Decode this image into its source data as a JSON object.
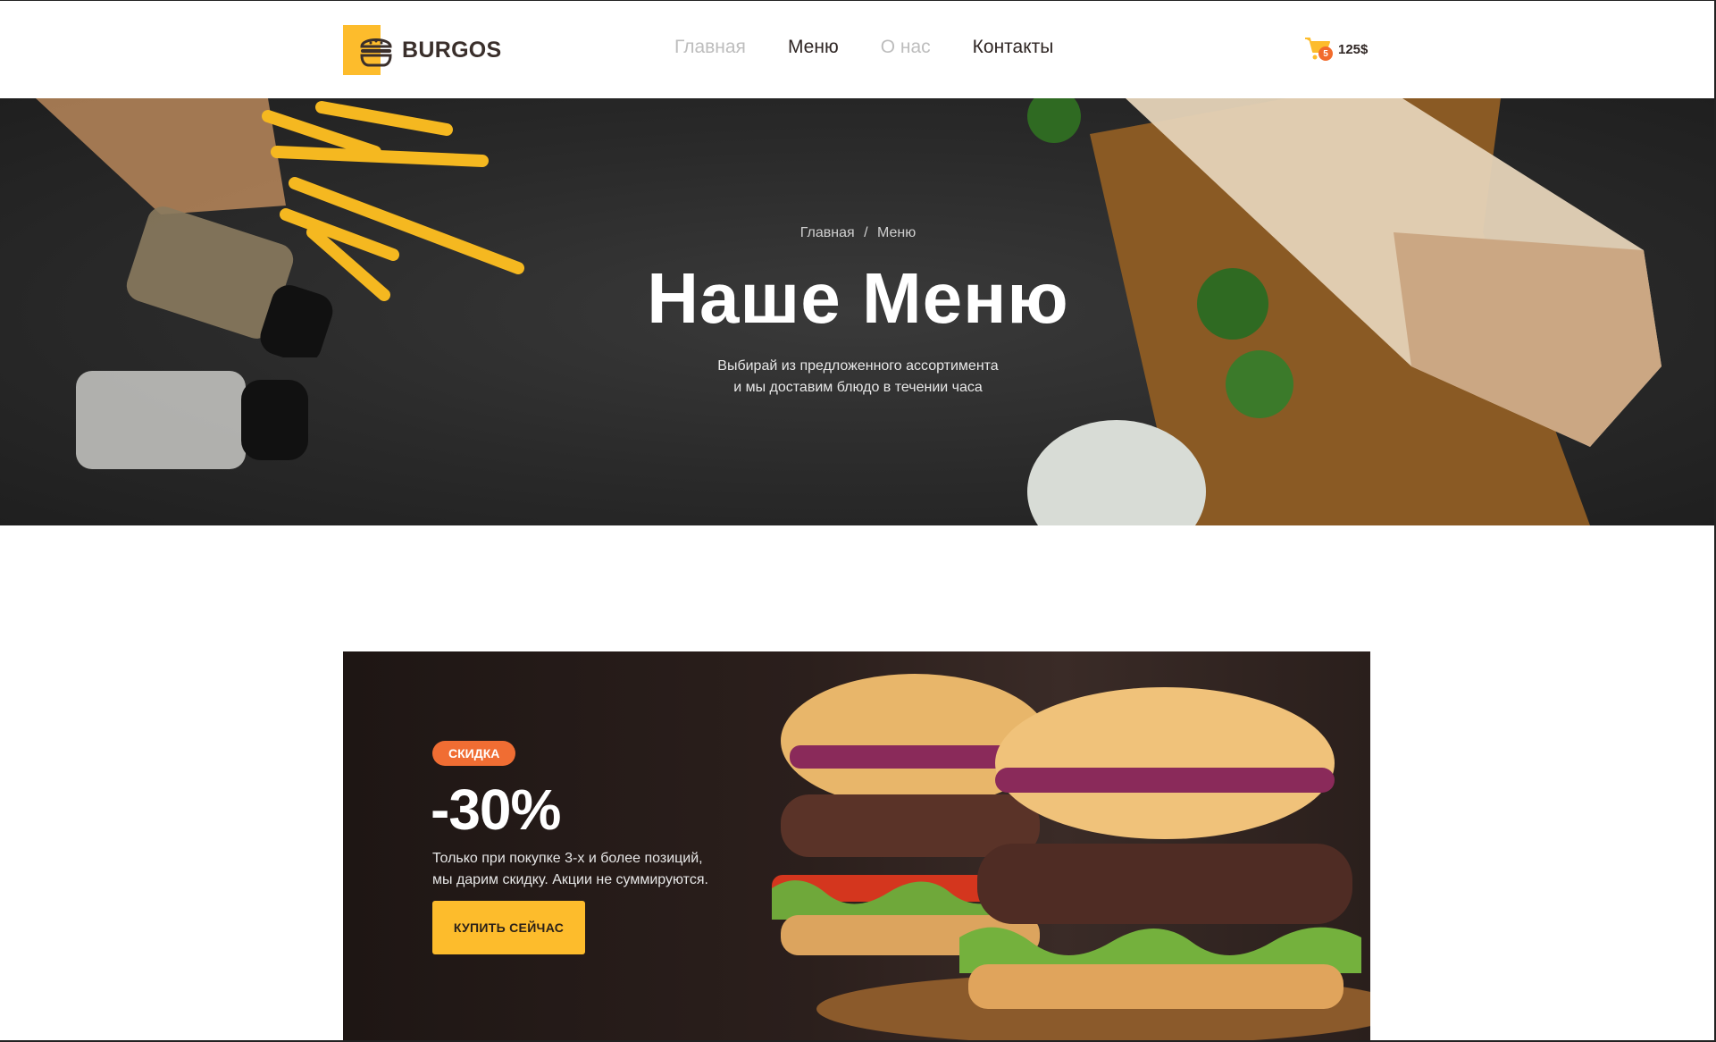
{
  "header": {
    "logo_text": "BURGOS",
    "nav": [
      {
        "label": "Главная",
        "state": "muted"
      },
      {
        "label": "Меню",
        "state": "active"
      },
      {
        "label": "О нас",
        "state": "muted"
      },
      {
        "label": "Контакты",
        "state": "normal"
      }
    ],
    "cart": {
      "count": "5",
      "total": "125$",
      "icon": "cart-icon"
    }
  },
  "hero": {
    "breadcrumb": {
      "home": "Главная",
      "separator": "/",
      "current": "Меню"
    },
    "title": "Наше Меню",
    "subtitle_line1": "Выбирай из предложенного ассортимента",
    "subtitle_line2": "и мы доставим блюдо в течении часа"
  },
  "promo": {
    "badge": "СКИДКА",
    "discount": "-30%",
    "text_line1": "Только при покупке 3-х и более позиций,",
    "text_line2": "мы дарим скидку. Акции не суммируются.",
    "button": "КУПИТЬ СЕЙЧАС"
  },
  "colors": {
    "accent_yellow": "#fdbc2c",
    "accent_orange": "#f06d33",
    "text_dark": "#2f2624",
    "nav_muted": "#bdbdbd"
  }
}
